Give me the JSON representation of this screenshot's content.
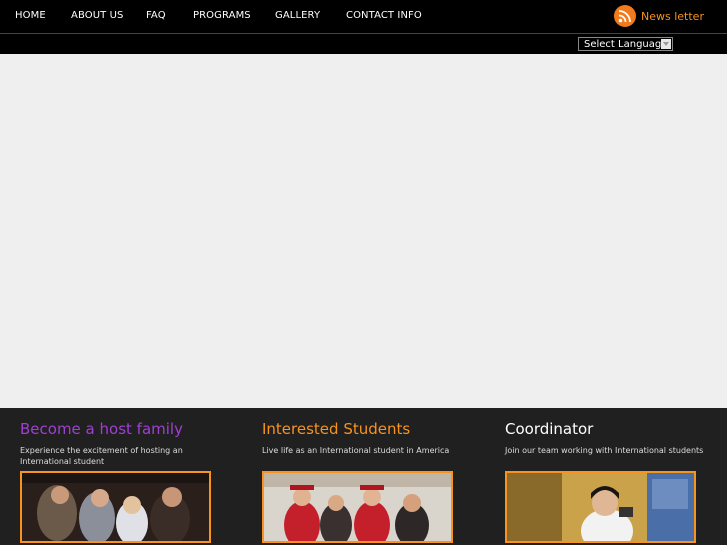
{
  "nav": {
    "items": [
      {
        "label": "HOME"
      },
      {
        "label": "ABOUT US"
      },
      {
        "label": "FAQ"
      },
      {
        "label": "PROGRAMS"
      },
      {
        "label": "GALLERY"
      },
      {
        "label": "CONTACT INFO"
      }
    ],
    "newsletter_label": "News letter",
    "newsletter_icon": "rss-icon"
  },
  "language": {
    "selected": "Select Language"
  },
  "colors": {
    "accent_orange": "#f7931e",
    "accent_purple": "#9b3bd2",
    "bottom_bg": "#202020",
    "hero_bg": "#efefef"
  },
  "features": [
    {
      "title": "Become a host family",
      "text": "Experience the excitement of hosting an International student",
      "color": "#a23ed6"
    },
    {
      "title": "Interested Students",
      "text": "Live life as an International student in America",
      "color": "#f7931e"
    },
    {
      "title": "Coordinator",
      "text": "Join our team working with International students",
      "color": "#ffffff"
    }
  ]
}
